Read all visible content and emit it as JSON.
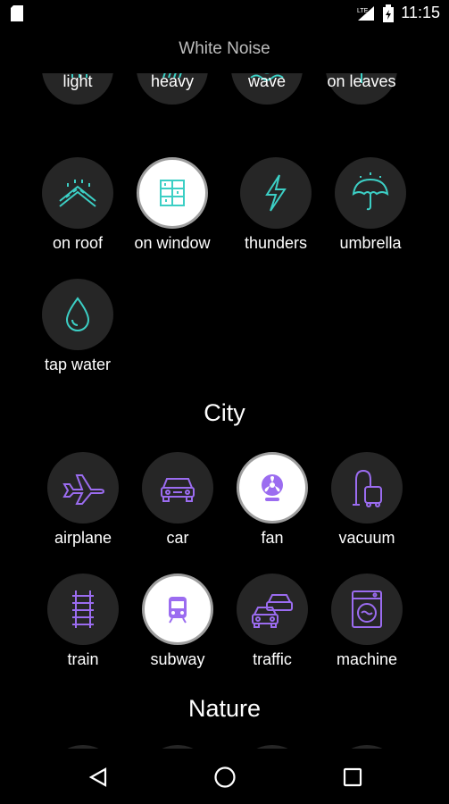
{
  "status": {
    "time": "11:15",
    "network": "LTE"
  },
  "app": {
    "title": "White Noise"
  },
  "colors": {
    "rain_accent": "#3ccfc5",
    "city_accent": "#9b6cf0",
    "circle_bg": "#262626"
  },
  "rain": {
    "row0": [
      {
        "label": "light",
        "icon": "light-rain-icon"
      },
      {
        "label": "heavy",
        "icon": "heavy-rain-icon"
      },
      {
        "label": "wave",
        "icon": "wave-icon"
      },
      {
        "label": "on leaves",
        "icon": "leaves-icon"
      }
    ],
    "row1": [
      {
        "label": "on roof",
        "icon": "roof-icon"
      },
      {
        "label": "on window",
        "icon": "window-icon",
        "selected": true
      },
      {
        "label": "thunders",
        "icon": "lightning-icon"
      },
      {
        "label": "umbrella",
        "icon": "umbrella-icon"
      }
    ],
    "row2": [
      {
        "label": "tap water",
        "icon": "water-drop-icon"
      }
    ]
  },
  "city": {
    "title": "City",
    "row0": [
      {
        "label": "airplane",
        "icon": "airplane-icon"
      },
      {
        "label": "car",
        "icon": "car-icon"
      },
      {
        "label": "fan",
        "icon": "fan-icon",
        "selected": true
      },
      {
        "label": "vacuum",
        "icon": "vacuum-icon"
      }
    ],
    "row1": [
      {
        "label": "train",
        "icon": "train-tracks-icon"
      },
      {
        "label": "subway",
        "icon": "subway-icon",
        "selected": true
      },
      {
        "label": "traffic",
        "icon": "traffic-icon"
      },
      {
        "label": "machine",
        "icon": "washing-machine-icon"
      }
    ]
  },
  "nature": {
    "title": "Nature"
  },
  "nav": {
    "back": "back-icon",
    "home": "home-icon",
    "recents": "recents-icon"
  }
}
